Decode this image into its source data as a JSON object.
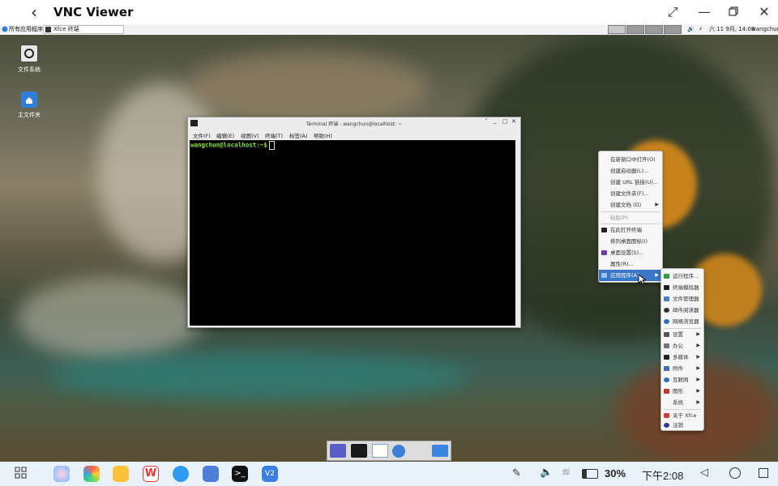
{
  "app": {
    "title": "VNC Viewer",
    "back_icon": "arrow-left-icon",
    "header_icons": [
      "expand-icon",
      "minimize-icon",
      "restore-icon",
      "close-icon"
    ]
  },
  "xfce_panel": {
    "apps_menu_label": "所有应用程序",
    "task_label": "Xfce 终端",
    "clock": "六 11 9月, 14:08",
    "user": "wangchun"
  },
  "desktop_icons": [
    {
      "label": "文件系统",
      "icon": "drive-icon"
    },
    {
      "label": "主文件夹",
      "icon": "home-folder-icon"
    }
  ],
  "terminal": {
    "title": "Terminal 终端 - wangchun@localhost: ~",
    "menu": [
      "文件(F)",
      "编辑(E)",
      "视图(V)",
      "终端(T)",
      "标签(A)",
      "帮助(H)"
    ],
    "prompt": "wangchun@localhost:~$"
  },
  "context_menu": {
    "items": [
      {
        "label": "在新窗口中打开(O)",
        "disabled": false
      },
      {
        "label": "创建启动器(L)...",
        "disabled": false
      },
      {
        "label": "创建 URL 链接(U)...",
        "disabled": false
      },
      {
        "label": "创建文件夹(F)...",
        "disabled": false
      },
      {
        "label": "创建文档 (D)",
        "disabled": false,
        "submenu": true
      },
      {
        "label": "粘贴(P)",
        "disabled": true
      },
      {
        "label": "在此打开终端",
        "disabled": false,
        "icon": "terminal-icon"
      },
      {
        "label": "排列桌面图标(I)",
        "disabled": false
      },
      {
        "label": "桌面设置(S)...",
        "disabled": false,
        "icon": "desktop-settings-icon"
      },
      {
        "label": "属性(R)...",
        "disabled": false
      },
      {
        "label": "应用程序(A)",
        "disabled": false,
        "active": true,
        "submenu": true,
        "icon": "applications-icon"
      }
    ]
  },
  "apps_submenu": {
    "items": [
      {
        "label": "运行程序...",
        "icon": "run-icon",
        "color": "#2e9d3a"
      },
      {
        "label": "终端模拟器",
        "icon": "terminal-icon",
        "color": "#222222"
      },
      {
        "label": "文件管理器",
        "icon": "file-manager-icon",
        "color": "#4a7cc9"
      },
      {
        "label": "邮件阅读器",
        "icon": "mail-icon",
        "color": "#333333"
      },
      {
        "label": "网络浏览器",
        "icon": "browser-icon",
        "color": "#2c6fb8"
      },
      {
        "label": "设置",
        "icon": "settings-icon",
        "color": "#555555",
        "submenu": true
      },
      {
        "label": "办公",
        "icon": "office-icon",
        "color": "#555555",
        "submenu": true
      },
      {
        "label": "多媒体",
        "icon": "multimedia-icon",
        "color": "#222222",
        "submenu": true
      },
      {
        "label": "附件",
        "icon": "accessories-icon",
        "color": "#3b6fb6",
        "submenu": true
      },
      {
        "label": "互联网",
        "icon": "internet-icon",
        "color": "#2c6fb8",
        "submenu": true
      },
      {
        "label": "图形",
        "icon": "graphics-icon",
        "color": "#c0392b",
        "submenu": true
      },
      {
        "label": "系统",
        "icon": "system-icon",
        "color": "#777777",
        "submenu": true
      },
      {
        "label": "关于 Xfce",
        "icon": "about-icon",
        "color": "#d23b3b"
      },
      {
        "label": "注销",
        "icon": "logout-icon",
        "color": "#2c3e8a"
      }
    ]
  },
  "dock_items": [
    "show-desktop-icon",
    "terminal-icon",
    "file-manager-icon",
    "browser-icon",
    "app-finder-icon",
    "folder-icon"
  ],
  "android_bar": {
    "apps": [
      "grid-icon",
      "app-1-icon",
      "photos-icon",
      "notes-icon",
      "wps-icon",
      "browser-icon",
      "feather-icon",
      "terminal-icon",
      "vnc-icon"
    ],
    "battery": "30%",
    "time": "下午2:08"
  }
}
